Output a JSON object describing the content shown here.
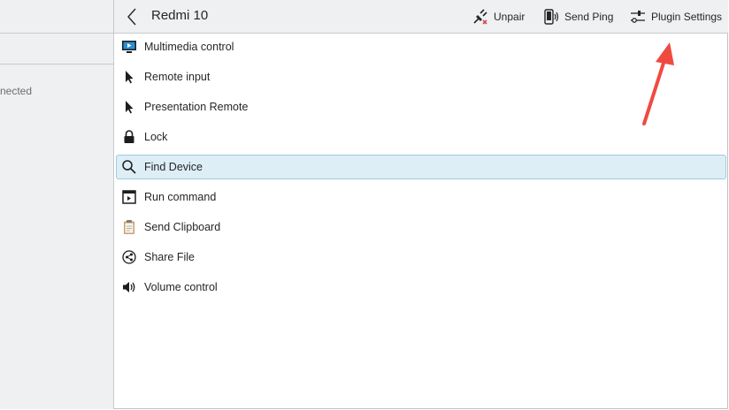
{
  "sidebar": {
    "status": "nected"
  },
  "header": {
    "device_name": "Redmi 10",
    "actions": [
      {
        "label": "Unpair",
        "icon": "unpair-icon"
      },
      {
        "label": "Send Ping",
        "icon": "phone-ping-icon"
      },
      {
        "label": "Plugin Settings",
        "icon": "sliders-icon"
      }
    ]
  },
  "plugins": [
    {
      "label": "Multimedia control",
      "icon": "monitor-play-icon"
    },
    {
      "label": "Remote input",
      "icon": "pointer-icon"
    },
    {
      "label": "Presentation Remote",
      "icon": "pointer-icon"
    },
    {
      "label": "Lock",
      "icon": "lock-icon"
    },
    {
      "label": "Find Device",
      "icon": "search-icon",
      "selected": true
    },
    {
      "label": "Run command",
      "icon": "terminal-window-icon"
    },
    {
      "label": "Send Clipboard",
      "icon": "clipboard-icon"
    },
    {
      "label": "Share File",
      "icon": "share-icon"
    },
    {
      "label": "Volume control",
      "icon": "speaker-icon"
    }
  ],
  "colors": {
    "annotation_arrow": "#f04a3f",
    "selection_bg": "#ddeef6",
    "selection_border": "#9fcbe1",
    "chrome_bg": "#eff0f1"
  }
}
